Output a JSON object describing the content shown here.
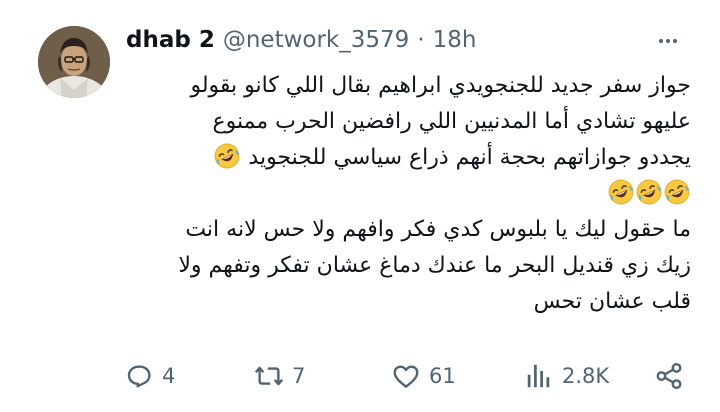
{
  "author": {
    "name": "dhab 2",
    "handle": "@network_3579",
    "separator": "·",
    "time": "18h"
  },
  "tweet": {
    "line1": "جواز سفر جديد للجنجويدي ابراهيم بقال اللي كانو بقولو",
    "line2": "عليهو تشادي أما المدنيين اللي رافضين الحرب ممنوع",
    "line3": "يجددو جوازاتهم بحجة أنهم ذراع سياسي للجنجويد",
    "line5": "ما حقول ليك يا بلبوس كدي فكر وافهم ولا حس لانه انت",
    "line6": "زيك زي قنديل البحر ما عندك دماغ عشان تفكر وتفهم ولا",
    "line7": "قلب عشان تحس",
    "emoji": "rolling-on-floor-laughing-emoji"
  },
  "actions": {
    "replies": "4",
    "reposts": "7",
    "likes": "61",
    "views": "2.8K"
  },
  "icons": {
    "reply": "reply-icon",
    "repost": "repost-icon",
    "like": "heart-icon",
    "views": "views-icon",
    "share": "share-icon",
    "more": "more-icon"
  },
  "colors": {
    "text": "#0f1419",
    "secondary": "#536471",
    "emoji_face": "#f7c842"
  }
}
